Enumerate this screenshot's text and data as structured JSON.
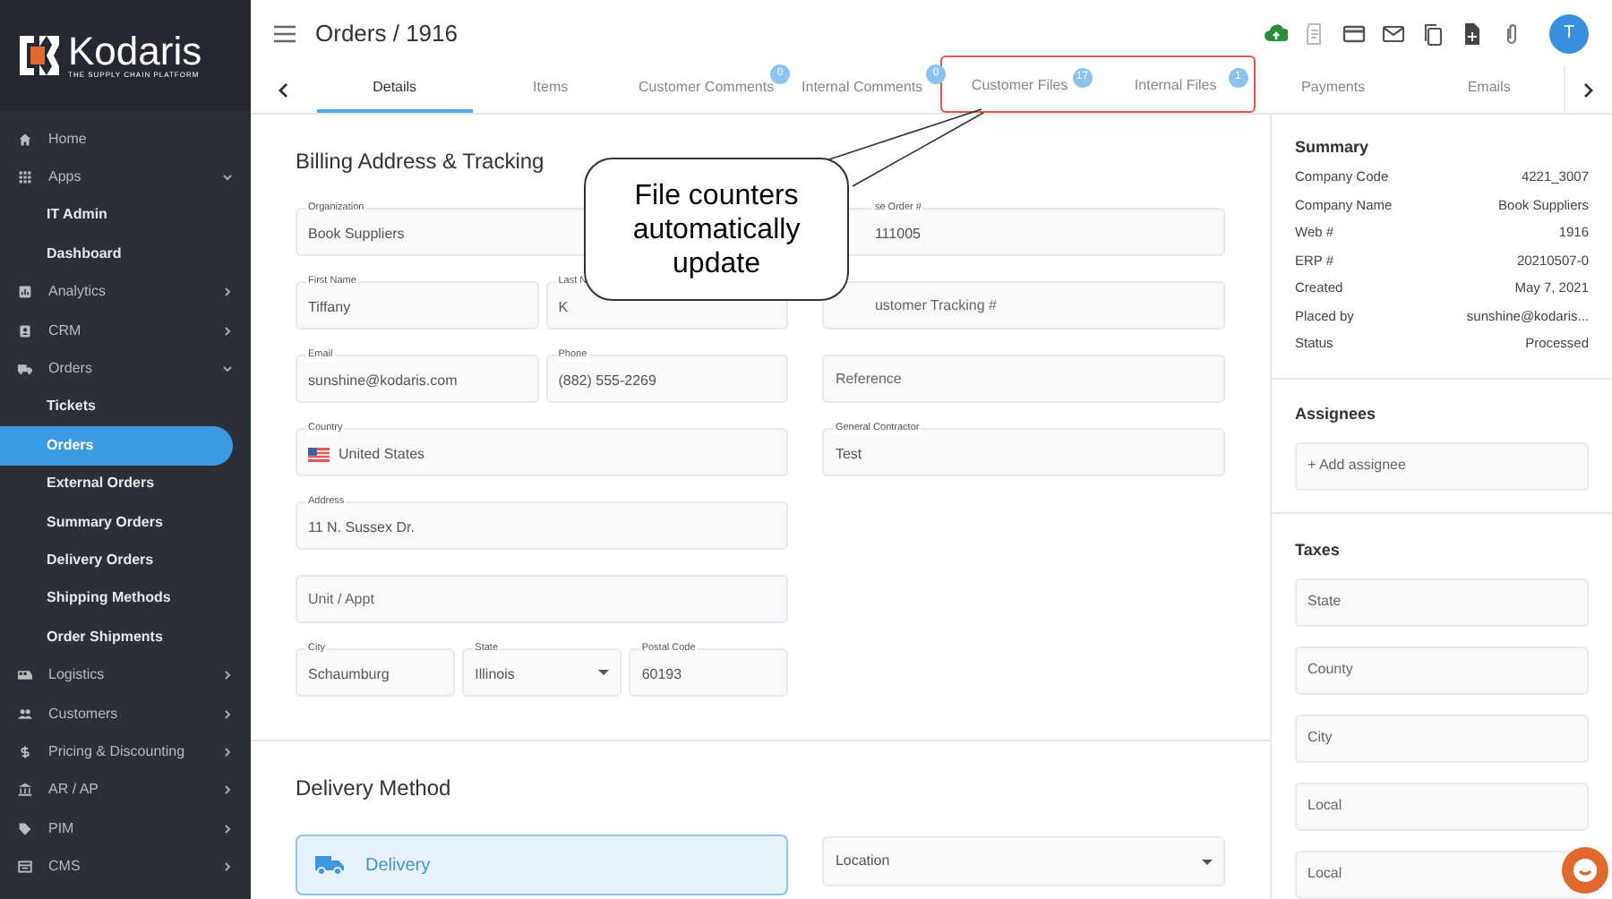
{
  "brand": {
    "name": "Kodaris",
    "tagline": "THE SUPPLY CHAIN PLATFORM"
  },
  "sidebar": {
    "items": [
      {
        "label": "Home",
        "selected": false
      },
      {
        "label": "Apps",
        "expanded": true,
        "selected": false,
        "children": [
          {
            "label": "IT Admin",
            "selected": false
          },
          {
            "label": "Dashboard",
            "selected": false
          }
        ]
      },
      {
        "label": "Analytics",
        "expanded": false,
        "selected": false
      },
      {
        "label": "CRM",
        "expanded": false,
        "selected": false
      },
      {
        "label": "Orders",
        "expanded": true,
        "selected": false,
        "children": [
          {
            "label": "Tickets",
            "selected": false
          },
          {
            "label": "Orders",
            "selected": true
          },
          {
            "label": "External Orders",
            "selected": false
          },
          {
            "label": "Summary Orders",
            "selected": false
          },
          {
            "label": "Delivery Orders",
            "selected": false
          },
          {
            "label": "Shipping Methods",
            "selected": false
          },
          {
            "label": "Order Shipments",
            "selected": false
          }
        ]
      },
      {
        "label": "Logistics",
        "expanded": false,
        "selected": false
      },
      {
        "label": "Customers",
        "expanded": false,
        "selected": false
      },
      {
        "label": "Pricing & Discounting",
        "expanded": false,
        "selected": false
      },
      {
        "label": "AR / AP",
        "expanded": false,
        "selected": false
      },
      {
        "label": "PIM",
        "expanded": false,
        "selected": false
      },
      {
        "label": "CMS",
        "expanded": false,
        "selected": false
      }
    ]
  },
  "header": {
    "title": "Orders / 1916",
    "avatar": "T"
  },
  "tabs": [
    {
      "label": "Details",
      "selected": true,
      "highlighted": false
    },
    {
      "label": "Items",
      "selected": false,
      "highlighted": false
    },
    {
      "label": "Customer Comments",
      "badge": "0",
      "selected": false,
      "highlighted": false
    },
    {
      "label": "Internal Comments",
      "badge": "0",
      "selected": false,
      "highlighted": false
    },
    {
      "label": "Customer Files",
      "badge": "17",
      "selected": false,
      "highlighted": true
    },
    {
      "label": "Internal Files",
      "badge": "1",
      "selected": false,
      "highlighted": true
    },
    {
      "label": "Payments",
      "selected": false,
      "highlighted": false
    },
    {
      "label": "Emails",
      "selected": false,
      "highlighted": false
    }
  ],
  "billing": {
    "title": "Billing Address & Tracking",
    "left_rows": [
      [
        {
          "kind": "text",
          "label": "Organization",
          "value": "Book Suppliers"
        }
      ],
      [
        {
          "kind": "text",
          "label": "First Name",
          "value": "Tiffany"
        },
        {
          "kind": "text",
          "label": "Last N",
          "value": "K"
        }
      ],
      [
        {
          "kind": "text",
          "label": "Email",
          "value": "sunshine@kodaris.com"
        },
        {
          "kind": "text",
          "label": "Phone",
          "value": "(882) 555-2269"
        }
      ],
      [
        {
          "kind": "country",
          "label": "Country",
          "value": "United States"
        }
      ],
      [
        {
          "kind": "text",
          "label": "Address",
          "value": "11 N. Sussex Dr."
        }
      ],
      [
        {
          "kind": "text",
          "placeholder": "Unit / Appt"
        }
      ],
      [
        {
          "kind": "text",
          "label": "City",
          "value": "Schaumburg"
        },
        {
          "kind": "select",
          "label": "State",
          "value": "Illinois"
        },
        {
          "kind": "text",
          "label": "Postal Code",
          "value": "60193"
        }
      ]
    ],
    "right_rows": [
      [
        {
          "kind": "partial",
          "label": "se Order #",
          "value": "111005"
        }
      ],
      [
        {
          "kind": "partial",
          "placeholder": "ustomer Tracking #"
        }
      ],
      [
        {
          "kind": "text",
          "placeholder": "Reference"
        }
      ],
      [
        {
          "kind": "text",
          "label": "General Contractor",
          "value": "Test"
        }
      ]
    ]
  },
  "delivery": {
    "title": "Delivery Method",
    "method": "Delivery",
    "location": {
      "placeholder": "Location"
    }
  },
  "summary": {
    "title": "Summary",
    "rows": [
      {
        "label": "Company Code",
        "value": "4221_3007"
      },
      {
        "label": "Company Name",
        "value": "Book Suppliers"
      },
      {
        "label": "Web #",
        "value": "1916"
      },
      {
        "label": "ERP #",
        "value": "20210507-0"
      },
      {
        "label": "Created",
        "value": "May 7, 2021"
      },
      {
        "label": "Placed by",
        "value": "sunshine@kodaris..."
      },
      {
        "label": "Status",
        "value": "Processed"
      }
    ]
  },
  "assignees": {
    "title": "Assignees",
    "placeholder": "+ Add assignee"
  },
  "taxes": {
    "title": "Taxes",
    "fields": [
      {
        "placeholder": "State"
      },
      {
        "placeholder": "County"
      },
      {
        "placeholder": "City"
      },
      {
        "placeholder": "Local"
      },
      {
        "placeholder": "Local"
      }
    ]
  },
  "callout": {
    "text": "File counters automatically update"
  }
}
